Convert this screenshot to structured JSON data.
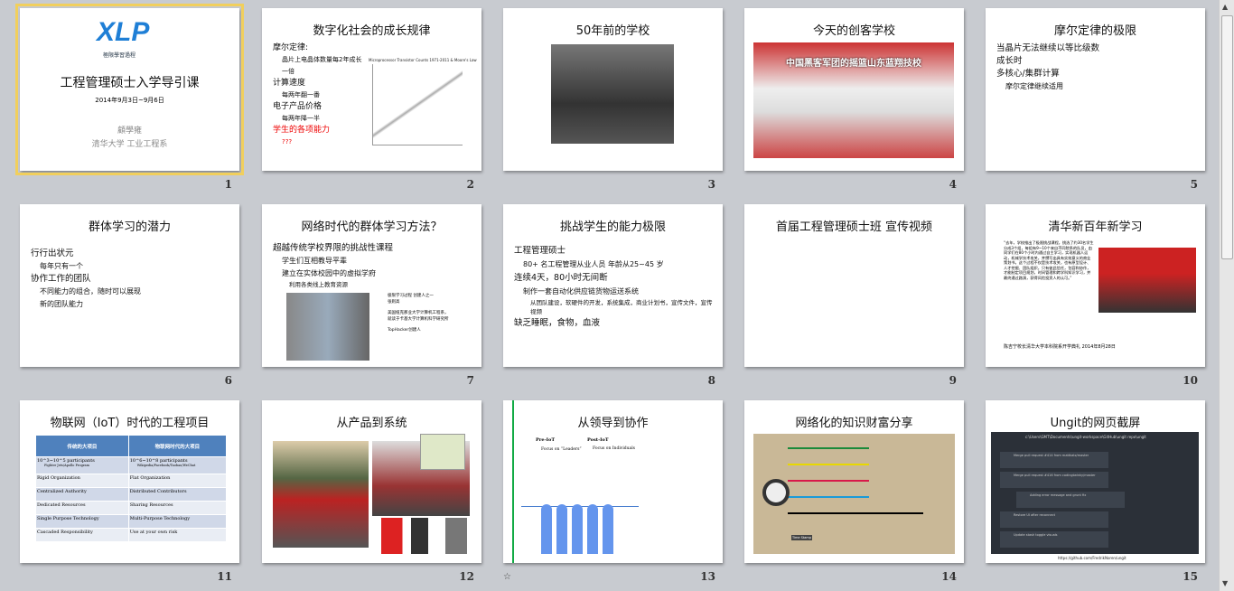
{
  "slides": [
    {
      "num": "1",
      "title": "工程管理硕士入学导引课",
      "logo": "XLP",
      "logo_sub": "極限學習過程",
      "date": "2014年9月3日~9月6日",
      "author": "顧學雍",
      "dept": "清华大学 工业工程系"
    },
    {
      "num": "2",
      "title": "数字化社会的成长规律",
      "bullets": [
        "摩尔定律:",
        "晶片上电晶体数量每2年成长一倍",
        "计算速度",
        "每两年翻一番",
        "电子产品价格",
        "每两年降一半",
        "学生的各项能力",
        "???"
      ],
      "chart_caption": "Microprocessor Transistor Counts 1971-2011 & Moore's Law"
    },
    {
      "num": "3",
      "title": "50年前的学校"
    },
    {
      "num": "4",
      "title": "今天的创客学校",
      "banner": "中国黑客军团的摇篮山东蓝翔技校"
    },
    {
      "num": "5",
      "title": "摩尔定律的极限",
      "bullets": [
        "当晶片无法继续以等比级数成长时",
        "多核心/集群计算",
        "摩尔定律继续适用"
      ]
    },
    {
      "num": "6",
      "title": "群体学习的潜力",
      "bullets": [
        "行行出状元",
        "每年只有一个",
        "协作工作的团队",
        "不同能力的组合，随时可以展现新的团队能力"
      ]
    },
    {
      "num": "7",
      "title": "网络时代的群体学习方法？",
      "bullets": [
        "超越传统学校界限的挑战性课程",
        "学生们互相教导平辈",
        "建立在实体校园中的虚拟学府",
        "利用各类线上教育资源"
      ],
      "caption": [
        "极限学习过程 创建人之一",
        "张则高",
        "美国纽克那业大学计算机工程系，",
        "就读于卡基大学计算机科学研究所",
        "TopHacker创建人"
      ]
    },
    {
      "num": "8",
      "title": "挑战学生的能力极限",
      "bullets": [
        "工程管理硕士",
        "80+ 名工程管理从业人员 年龄从25~45 岁",
        "连续4天，80小时无间断",
        "制作一套自动化供应链货物运送系统",
        "从团队建设，软硬件的开发，系统集成，商业计划书，宣传文件，宣传视频",
        "缺乏睡眠，食物，血液"
      ]
    },
    {
      "num": "9",
      "title": "首届工程管理硕士班 宣传视频"
    },
    {
      "num": "10",
      "title": "清华新百年新学习",
      "quote": "“去年，学校推出了极限挑战课程，挑选了约30名学生分成3个组，每组有9~10个来自不同院系的队员，由同学们在80个小时内通过自主学习，实现机器人运动，机械学技术攻关，并撰写出具有实效意义的商业策划书。这个过程不仅是技术攻关，也有原型设计、人才挖掘、团队组织，只有彼此信任，包容和协作，才能制定项目规划，时间管理和跨学科知识学习，并最终通过路演，获得风险投资人的认可。”",
      "source": "陈吉宁校长清华大学本科院系开学典礼 2014年8月28日"
    },
    {
      "num": "11",
      "title": "物联网（IoT）时代的工程项目",
      "table": {
        "headers": [
          "传统的大项目",
          "物联网时代的大项目"
        ],
        "rows": [
          [
            "10^3~10^5 participants",
            "10^6~10^8 participants"
          ],
          [
            "Rigid Organization",
            "Flat Organization"
          ],
          [
            "Centralized Authority",
            "Distributed Contributors"
          ],
          [
            "Dedicated Resources",
            "Sharing Resources"
          ],
          [
            "Single Purpose Technology",
            "Multi-Purpose Technology"
          ],
          [
            "Cascaded Responsibility",
            "Use at your own risk"
          ]
        ],
        "sub": [
          "Fighter Jets/Apollo Program",
          "Wikipedia/Facebook/Taobao/WeChat"
        ]
      }
    },
    {
      "num": "12",
      "title": "从产品到系统"
    },
    {
      "num": "13",
      "title": "从领导到协作",
      "pre": "Pre-IoT",
      "pre_sub": "Focus on “Leaders”",
      "post": "Post-IoT",
      "post_sub": "Focus on Individuals",
      "has_animation": true
    },
    {
      "num": "14",
      "title": "网络化的知识财富分享",
      "label": "Time Stamp"
    },
    {
      "num": "15",
      "title": "Ungit的网页截屏",
      "path": "c:\\Users\\GMT\\Documents\\ungit-workspace\\GitHub\\ungit repo\\ungit",
      "commits": [
        "Merge pull request #414 from mattkatz/master",
        "Merge pull request #416 from codingtwinky/master",
        "Adding error message and grunt fix",
        "Restore UI after reconnect",
        "Update stash toggle visuals"
      ],
      "url": "https://github.com/FredrikNoren/ungit"
    }
  ]
}
